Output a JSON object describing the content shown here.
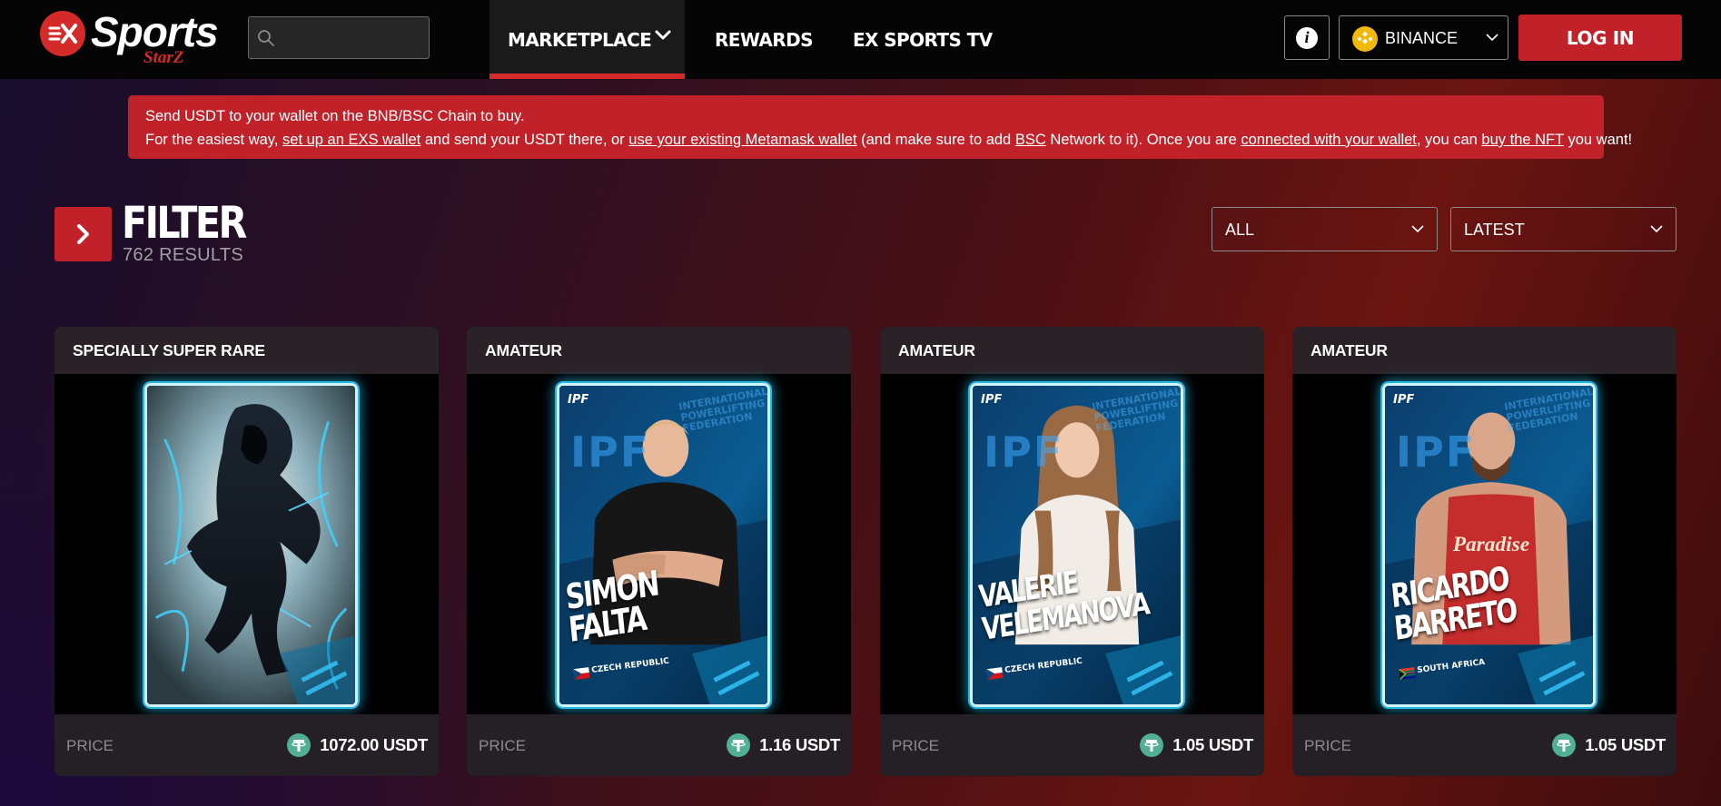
{
  "header": {
    "logo": {
      "brand_text": "Sports",
      "sub_text": "StarZ"
    },
    "search": {
      "placeholder": "",
      "value": ""
    },
    "nav": [
      {
        "label": "MARKETPLACE",
        "active": true,
        "has_dropdown": true
      },
      {
        "label": "REWARDS",
        "active": false
      },
      {
        "label": "EX SPORTS TV",
        "active": false
      }
    ],
    "info_icon": "info-icon",
    "chain": {
      "selected": "BINANCE",
      "icon": "bnb-icon"
    },
    "login_label": "LOG IN"
  },
  "notice": {
    "line1": "Send USDT to your wallet on the BNB/BSC Chain to buy.",
    "line2_parts": [
      {
        "text": "For the easiest way, ",
        "link": false
      },
      {
        "text": "set up an EXS wallet",
        "link": true
      },
      {
        "text": " and send your USDT there, or ",
        "link": false
      },
      {
        "text": "use your existing Metamask wallet",
        "link": true
      },
      {
        "text": " (and make sure to add ",
        "link": false
      },
      {
        "text": "BSC",
        "link": true
      },
      {
        "text": " Network to it). Once you are ",
        "link": false
      },
      {
        "text": "connected with your wallet",
        "link": true
      },
      {
        "text": ", you can ",
        "link": false
      },
      {
        "text": "buy the NFT",
        "link": true
      },
      {
        "text": " you want!",
        "link": false
      }
    ]
  },
  "filter": {
    "title": "FILTER",
    "results": "762 RESULTS",
    "category_select": "ALL",
    "sort_select": "LATEST"
  },
  "cards": [
    {
      "rarity": "SPECIALLY SUPER RARE",
      "price_label": "PRICE",
      "price": "1072.00 USDT",
      "art": "hooded-runner",
      "player_name": "",
      "country": ""
    },
    {
      "rarity": "AMATEUR",
      "price_label": "PRICE",
      "price": "1.16 USDT",
      "art": "ipf-player",
      "player_name": "SIMON FALTA",
      "country": "CZECH REPUBLIC",
      "ipf_badge": "IPF",
      "federation": "INTERNATIONAL POWERLIFTING FEDERATION"
    },
    {
      "rarity": "AMATEUR",
      "price_label": "PRICE",
      "price": "1.05 USDT",
      "art": "ipf-player",
      "player_name": "VALERIE VELEMANOVA",
      "country": "CZECH REPUBLIC",
      "ipf_badge": "IPF",
      "federation": "INTERNATIONAL POWERLIFTING FEDERATION"
    },
    {
      "rarity": "AMATEUR",
      "price_label": "PRICE",
      "price": "1.05 USDT",
      "art": "ipf-player",
      "player_name": "RICARDO BARRETO",
      "country": "SOUTH AFRICA",
      "ipf_badge": "IPF",
      "federation": "INTERNATIONAL POWERLIFTING FEDERATION"
    }
  ],
  "colors": {
    "accent": "#c1222a",
    "header_bg": "#050505",
    "card_glow": "#27b9e6",
    "tether": "#50af95"
  }
}
